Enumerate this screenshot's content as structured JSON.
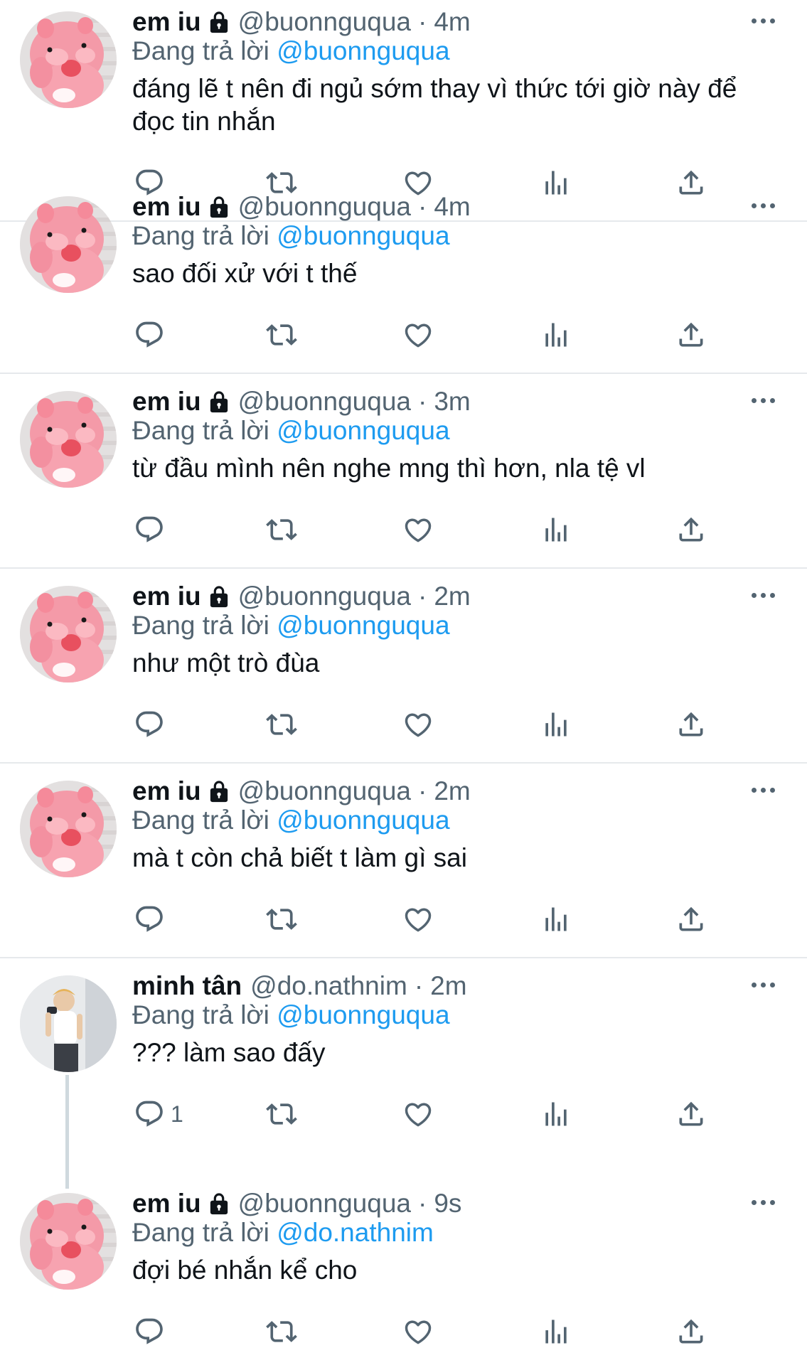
{
  "colors": {
    "accent": "#1d9bf0",
    "text": "#0f1419",
    "muted": "#536471",
    "divider": "#e6e9ec"
  },
  "icons": {
    "reply": "comment-bubble-icon",
    "retweet": "retweet-icon",
    "like": "heart-icon",
    "views": "bar-chart-icon",
    "share": "share-upload-icon",
    "more": "more-dots-icon",
    "private": "lock-icon"
  },
  "reply_prefix": "Đang trả lời",
  "tweets": [
    {
      "name": "em iu",
      "handle": "@buonnguqua",
      "time": "4m",
      "reply_to": "@buonnguqua",
      "text": "đáng lẽ t nên đi ngủ sớm thay vì thức tới giờ này để đọc tin nhắn",
      "reply_count": ""
    },
    {
      "name": "em iu",
      "handle": "@buonnguqua",
      "time": "4m",
      "reply_to": "@buonnguqua",
      "text": "sao đối xử với t thế",
      "reply_count": ""
    },
    {
      "name": "em iu",
      "handle": "@buonnguqua",
      "time": "3m",
      "reply_to": "@buonnguqua",
      "text": "từ đầu mình nên nghe mng thì hơn, nla tệ vl",
      "reply_count": ""
    },
    {
      "name": "em iu",
      "handle": "@buonnguqua",
      "time": "2m",
      "reply_to": "@buonnguqua",
      "text": "như một trò đùa",
      "reply_count": ""
    },
    {
      "name": "em iu",
      "handle": "@buonnguqua",
      "time": "2m",
      "reply_to": "@buonnguqua",
      "text": "mà t còn chả biết t làm gì sai",
      "reply_count": ""
    },
    {
      "name": "minh tân",
      "handle": "@do.nathnim",
      "time": "2m",
      "reply_to": "@buonnguqua",
      "text": "??? làm sao đấy",
      "reply_count": "1"
    },
    {
      "name": "em iu",
      "handle": "@buonnguqua",
      "time": "9s",
      "reply_to": "@do.nathnim",
      "text": "đợi bé nhắn kể cho",
      "reply_count": ""
    }
  ]
}
